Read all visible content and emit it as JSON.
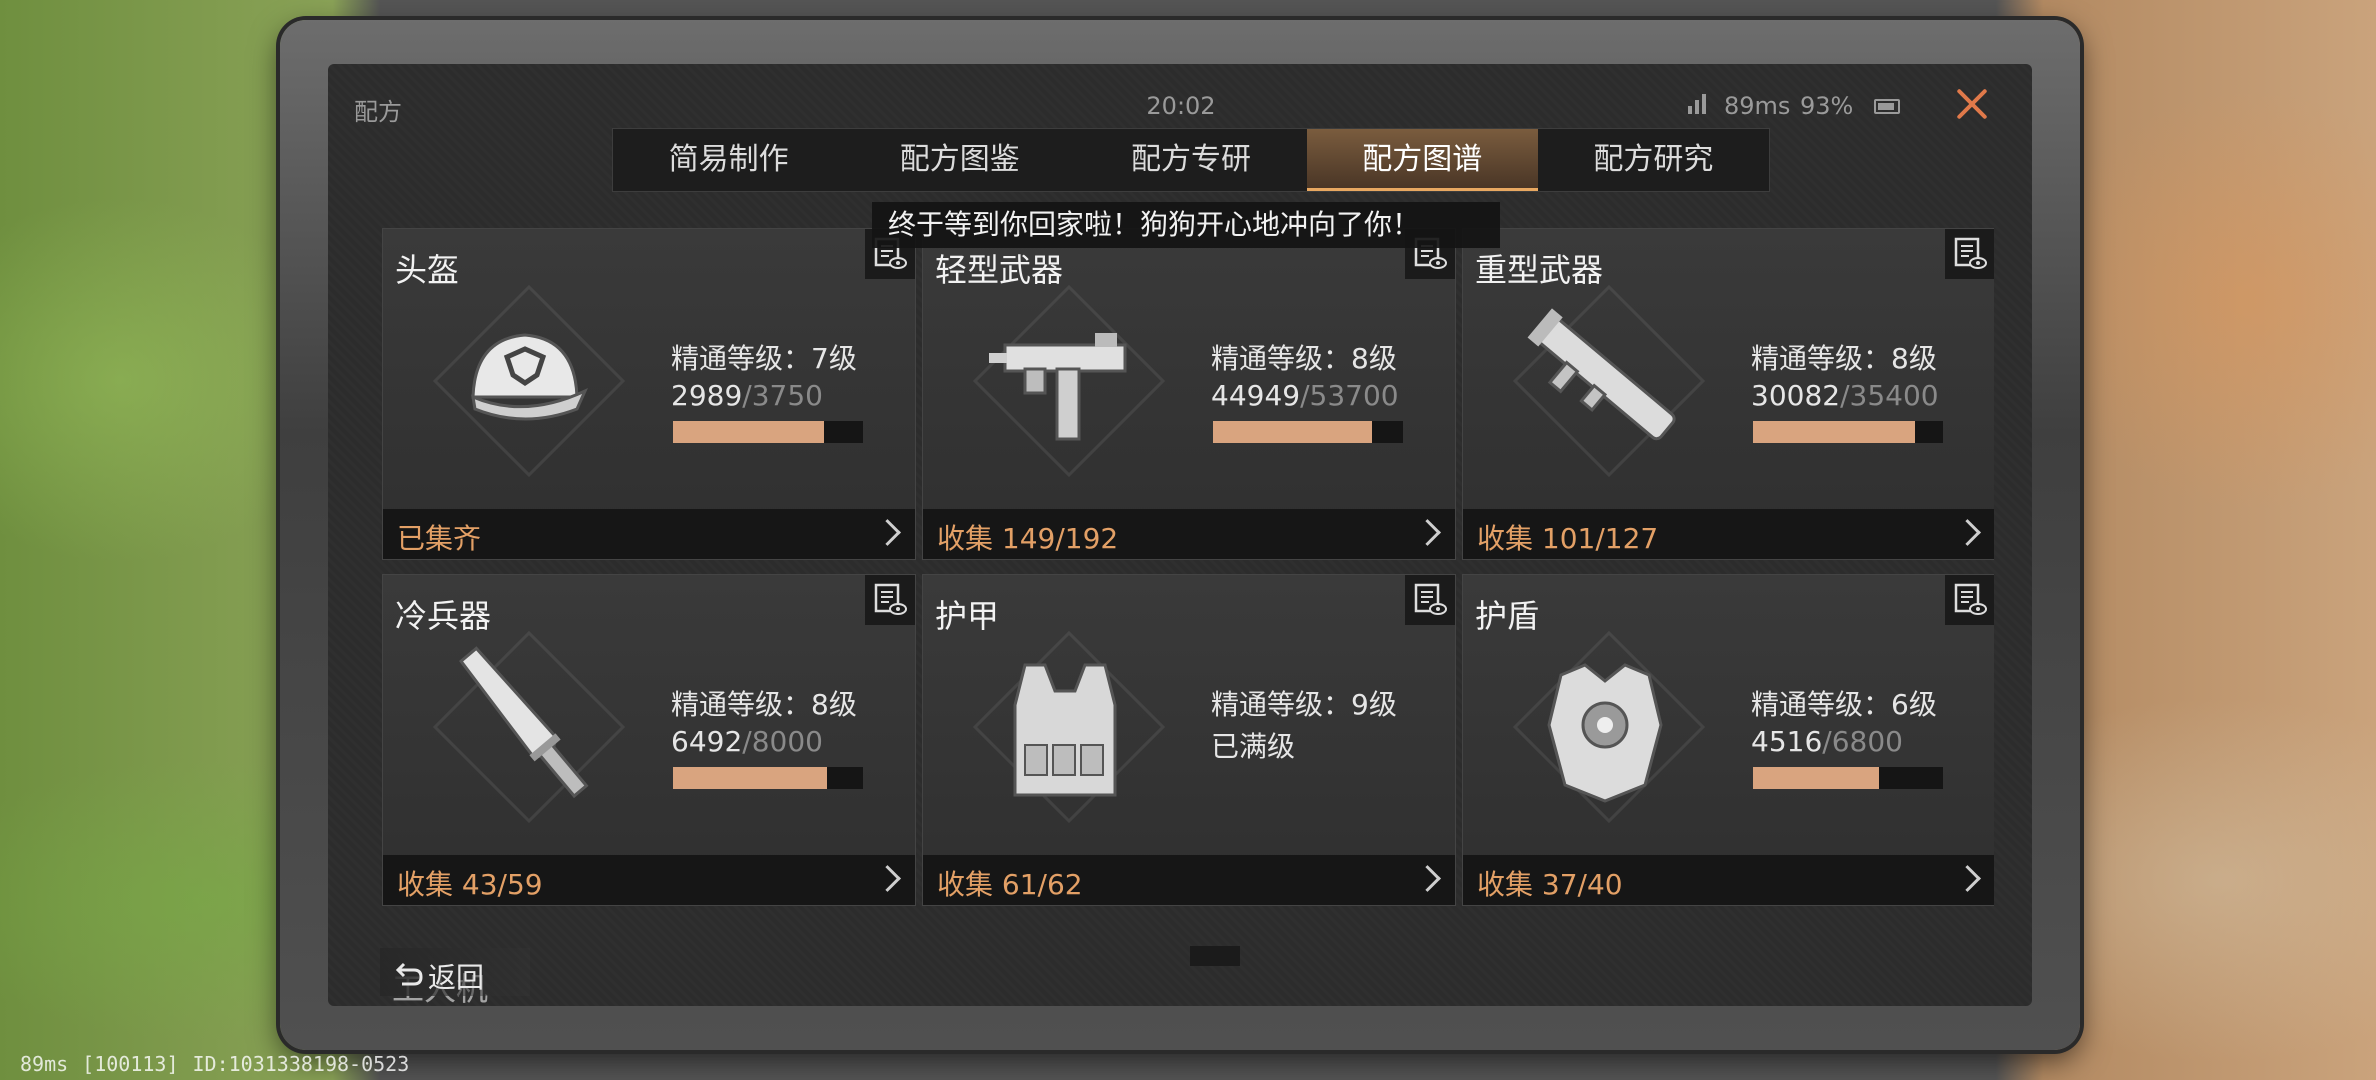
{
  "header": {
    "title": "配方",
    "time": "20:02",
    "ping": "89ms",
    "battery": "93%"
  },
  "tabs": [
    {
      "label": "简易制作",
      "active": false
    },
    {
      "label": "配方图鉴",
      "active": false
    },
    {
      "label": "配方专研",
      "active": false
    },
    {
      "label": "配方图谱",
      "active": true
    },
    {
      "label": "配方研究",
      "active": false
    }
  ],
  "toast": "终于等到你回家啦！狗狗开心地冲向了你！",
  "cards": [
    {
      "name": "头盔",
      "icon": "helmet-cap-icon",
      "level": "精通等级：7级",
      "progress_current": "2989",
      "progress_max": "/3750",
      "fill": 0.797,
      "footer": "已集齐"
    },
    {
      "name": "轻型武器",
      "icon": "smg-icon",
      "level": "精通等级：8级",
      "progress_current": "44949",
      "progress_max": "/53700",
      "fill": 0.837,
      "footer": "收集 149/192"
    },
    {
      "name": "重型武器",
      "icon": "rocket-launcher-icon",
      "level": "精通等级：8级",
      "progress_current": "30082",
      "progress_max": "/35400",
      "fill": 0.85,
      "footer": "收集 101/127"
    },
    {
      "name": "冷兵器",
      "icon": "machete-icon",
      "level": "精通等级：8级",
      "progress_current": "6492",
      "progress_max": "/8000",
      "fill": 0.81,
      "footer": "收集 43/59"
    },
    {
      "name": "护甲",
      "icon": "vest-icon",
      "level": "精通等级：9级",
      "status_text": "已满级",
      "fill": null,
      "footer": "收集 61/62"
    },
    {
      "name": "护盾",
      "icon": "shield-armor-icon",
      "level": "精通等级：6级",
      "progress_current": "4516",
      "progress_max": "/6800",
      "fill": 0.664,
      "footer": "收集 37/40"
    }
  ],
  "partial_card_name": "工人机",
  "back_label": "返回",
  "bottom_status": {
    "ping": "89ms",
    "server": "[100113]",
    "id": "ID:1031338198-0523"
  },
  "colors": {
    "accent": "#e3a066",
    "progress_fill": "#d9a47f",
    "close": "#e0794a"
  }
}
